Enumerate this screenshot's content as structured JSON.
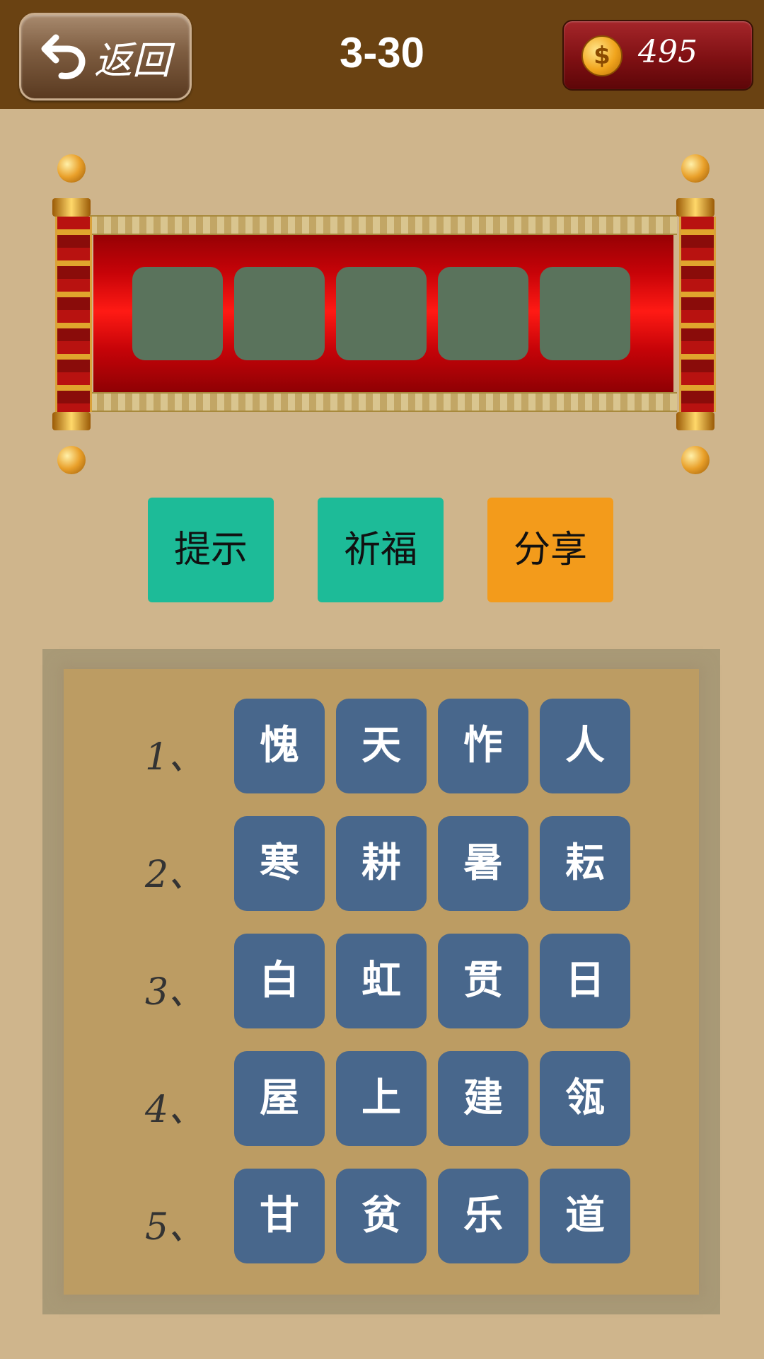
{
  "header": {
    "back_label": "返回",
    "level": "3-30",
    "coins": "495",
    "coin_symbol": "$"
  },
  "answer": {
    "slots": [
      "",
      "",
      "",
      "",
      ""
    ],
    "slot_color": "#5a735c"
  },
  "actions": {
    "hint": "提示",
    "pray": "祈福",
    "share": "分享"
  },
  "rows": [
    {
      "num": "1、",
      "chars": [
        "愧",
        "天",
        "怍",
        "人"
      ]
    },
    {
      "num": "2、",
      "chars": [
        "寒",
        "耕",
        "暑",
        "耘"
      ]
    },
    {
      "num": "3、",
      "chars": [
        "白",
        "虹",
        "贯",
        "日"
      ]
    },
    {
      "num": "4、",
      "chars": [
        "屋",
        "上",
        "建",
        "瓴"
      ]
    },
    {
      "num": "5、",
      "chars": [
        "甘",
        "贫",
        "乐",
        "道"
      ]
    }
  ],
  "colors": {
    "background": "#cfb58c",
    "topbar": "#6a4212",
    "tile": "#48678c",
    "hint_button": "#1dbb98",
    "share_button": "#f39b1b"
  }
}
